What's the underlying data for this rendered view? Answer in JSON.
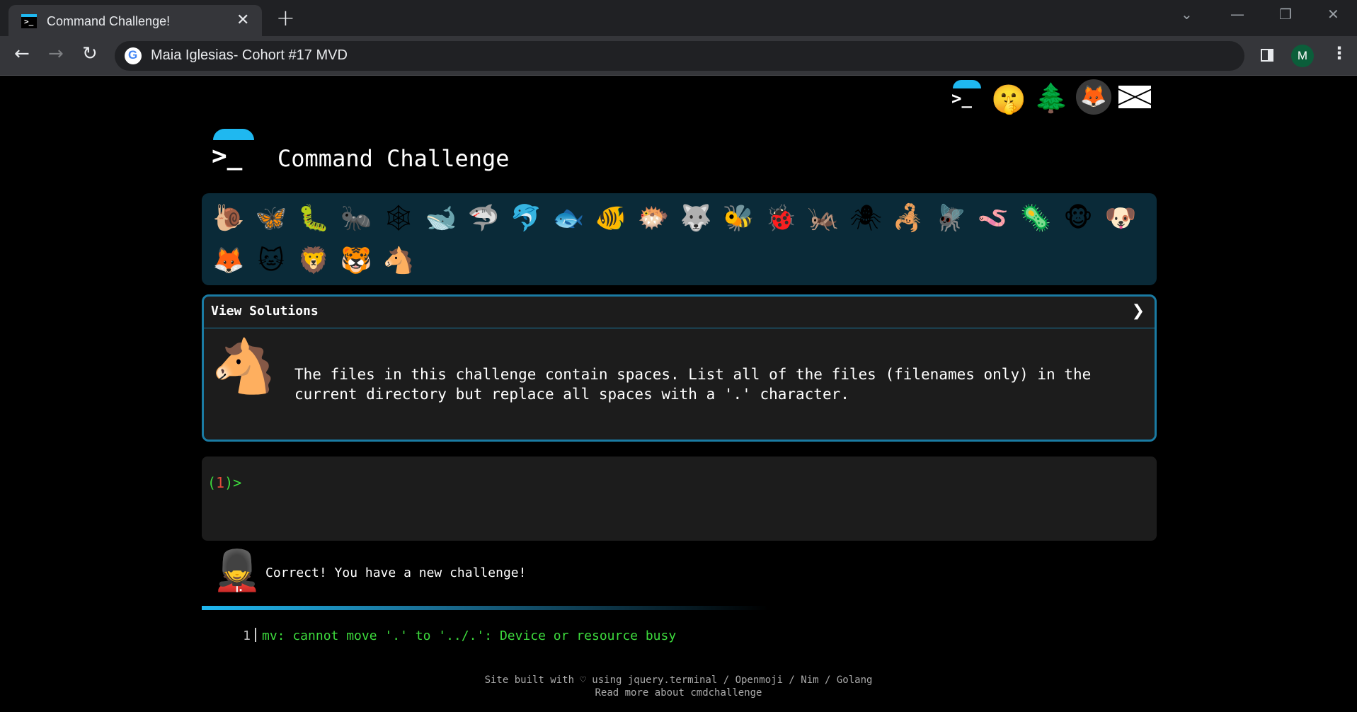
{
  "browser": {
    "tab_title": "Command Challenge!",
    "tab_close": "✕",
    "new_tab": "+",
    "url": "Maia Iglesias- Cohort #17 MVD",
    "avatar_letter": "M",
    "back": "←",
    "forward": "→",
    "reload": "↻",
    "menu": "⋮",
    "minimize": "—",
    "restore": "❐",
    "close": "✕",
    "tab_search": "⌄"
  },
  "header": {
    "icons": [
      {
        "name": "terminal-logo-icon",
        "glyph": ">_"
      },
      {
        "name": "shushing-face-icon",
        "glyph": "🤫"
      },
      {
        "name": "evergreen-tree-icon",
        "glyph": "🌲"
      },
      {
        "name": "gitlab-icon",
        "glyph": "🦊"
      },
      {
        "name": "envelope-icon",
        "glyph": "✉"
      }
    ]
  },
  "site": {
    "logo_glyph": ">_",
    "title": "Command Challenge"
  },
  "emoji_bar": {
    "row1": [
      {
        "name": "snail-icon",
        "glyph": "🐌"
      },
      {
        "name": "butterfly-icon",
        "glyph": "🦋"
      },
      {
        "name": "caterpillar-icon",
        "glyph": "🐛"
      },
      {
        "name": "ant-icon",
        "glyph": "🐜"
      },
      {
        "name": "spider-web-icon",
        "glyph": "🕸"
      },
      {
        "name": "whale-icon",
        "glyph": "🐋"
      },
      {
        "name": "shark-icon",
        "glyph": "🦈"
      },
      {
        "name": "dolphin-icon",
        "glyph": "🐬"
      },
      {
        "name": "fish-icon",
        "glyph": "🐟"
      },
      {
        "name": "tropical-fish-icon",
        "glyph": "🐠"
      },
      {
        "name": "blowfish-icon",
        "glyph": "🐡"
      },
      {
        "name": "wolf-icon",
        "glyph": "🐺"
      },
      {
        "name": "bee-icon",
        "glyph": "🐝"
      },
      {
        "name": "ladybug-icon",
        "glyph": "🐞"
      },
      {
        "name": "cricket-icon",
        "glyph": "🦗"
      },
      {
        "name": "spider-icon",
        "glyph": "🕷"
      },
      {
        "name": "scorpion-icon",
        "glyph": "🦂"
      },
      {
        "name": "fly-icon",
        "glyph": "🪰"
      },
      {
        "name": "worm-icon",
        "glyph": "🪱"
      },
      {
        "name": "microbe-icon",
        "glyph": "🦠"
      },
      {
        "name": "monkey-face-icon",
        "glyph": "🐵"
      },
      {
        "name": "dog-face-icon",
        "glyph": "🐶"
      }
    ],
    "row2": [
      {
        "name": "fox-icon",
        "glyph": "🦊"
      },
      {
        "name": "cat-face-icon",
        "glyph": "🐱"
      },
      {
        "name": "lion-icon",
        "glyph": "🦁"
      },
      {
        "name": "tiger-face-icon",
        "glyph": "🐯"
      },
      {
        "name": "horse-face-icon",
        "glyph": "🐴"
      }
    ]
  },
  "challenge": {
    "view_solutions": "View Solutions",
    "chevron": "❯",
    "avatar_glyph": "🐴",
    "description": "The files in this challenge contain spaces. List all of the files (filenames only) in the current directory but replace all spaces with a '.' character."
  },
  "terminal": {
    "prompt_open": "(",
    "prompt_number": "1",
    "prompt_close": ")>"
  },
  "feedback": {
    "guard_glyph": "💂",
    "message": "Correct! You have a new challenge!"
  },
  "output": {
    "line_number": "1",
    "text": "mv: cannot move '.' to '../.': Device or resource busy"
  },
  "footer": {
    "line1": "Site built with ♡ using jquery.terminal / Openmoji / Nim / Golang",
    "line2": "Read more about cmdchallenge"
  }
}
